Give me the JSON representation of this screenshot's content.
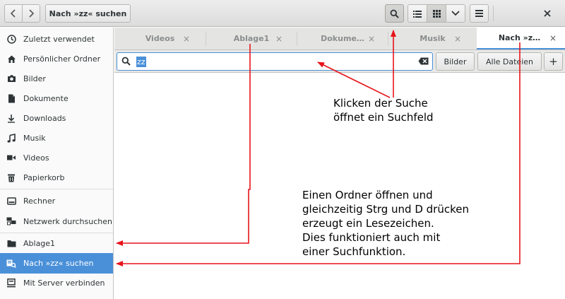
{
  "header": {
    "path_label": "Nach »zz« suchen"
  },
  "sidebar": {
    "items": [
      {
        "label": "Zuletzt verwendet",
        "icon": "clock-icon"
      },
      {
        "label": "Persönlicher Ordner",
        "icon": "home-icon"
      },
      {
        "label": "Bilder",
        "icon": "camera-icon"
      },
      {
        "label": "Dokumente",
        "icon": "document-icon"
      },
      {
        "label": "Downloads",
        "icon": "download-icon"
      },
      {
        "label": "Musik",
        "icon": "music-icon"
      },
      {
        "label": "Videos",
        "icon": "video-icon"
      },
      {
        "label": "Papierkorb",
        "icon": "trash-icon"
      },
      {
        "label": "Rechner",
        "icon": "drive-icon"
      },
      {
        "label": "Netzwerk durchsuchen",
        "icon": "network-icon"
      },
      {
        "label": "Ablage1",
        "icon": "folder-icon"
      },
      {
        "label": "Nach »zz« suchen",
        "icon": "saved-search-icon",
        "active": true
      },
      {
        "label": "Mit Server verbinden",
        "icon": "server-icon"
      }
    ]
  },
  "tabs": [
    {
      "label": "Videos"
    },
    {
      "label": "Ablage1"
    },
    {
      "label": "Dokume…"
    },
    {
      "label": "Musik"
    },
    {
      "label": "Nach »z…",
      "active": true
    }
  ],
  "tab_close_glyph": "×",
  "search": {
    "value": "zz",
    "filters": [
      "Bilder",
      "Alle Dateien"
    ],
    "add_label": "+"
  },
  "annotations": {
    "search_note": [
      "Klicken der Suche",
      "öffnet ein Suchfeld"
    ],
    "bookmark_note": [
      "Einen Ordner öffnen und",
      "gleichzeitig Strg und D drücken",
      "erzeugt ein Lesezeichen.",
      "Dies funktioniert auch mit",
      "einer Suchfunktion."
    ]
  },
  "colors": {
    "accent": "#4a90d9",
    "annotation_arrow": "#e8141b"
  }
}
